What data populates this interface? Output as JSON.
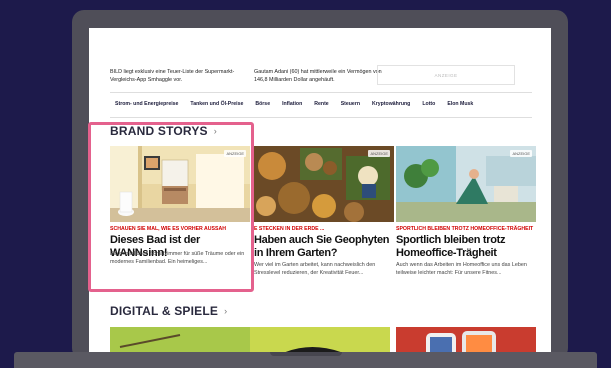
{
  "top_teasers": [
    {
      "text": "BILD liegt exklusiv eine Teuer-Liste der Supermarkt-Vergleichs-App Smhaggle vor."
    },
    {
      "text": "Gautam Adani (60) hat mittlerweile ein Vermögen von 146,8 Milliarden Dollar angehäuft."
    }
  ],
  "ad_label": "ANZEIGE",
  "nav": [
    "Strom- und Energiepreise",
    "Tanken und Öl-Preise",
    "Börse",
    "Inflation",
    "Rente",
    "Steuern",
    "Kryptowährung",
    "Lotto",
    "Elon Musk"
  ],
  "sections": {
    "brand_storys": {
      "title": "BRAND STORYS",
      "chevron": "›"
    },
    "digital_spiele": {
      "title": "DIGITAL & SPIELE",
      "chevron": "›"
    }
  },
  "cards": [
    {
      "badge": "ANZEIGE",
      "kicker": "SCHAUEN SIE MAL, WIE ES VORHER AUSSAH",
      "headline": "Dieses Bad ist der WANNsinn!",
      "summary": "Ein gemütliches Schlafzimmer für süße Träume oder ein modernes Familienbad. Ein heimeliges..."
    },
    {
      "badge": "ANZEIGE",
      "kicker": "E STECKEN IN DER ERDE ...",
      "headline": "Haben auch Sie Geophyten in Ihrem Garten?",
      "summary": "Wer viel im Garten arbeitet, kann nachweislich den Stresslevel reduzieren, der Kreativität Feuer..."
    },
    {
      "badge": "ANZEIGE",
      "kicker": "SPORTLICH BLEIBEN TROTZ HOMEOFFICE-TRÄGHEIT",
      "headline": "Sportlich bleiben trotz Homeoffice-Trägheit",
      "summary": "Auch wenn das Arbeiten im Homeoffice uns das Leben teilweise leichter macht: Für unsere Fitnes..."
    }
  ]
}
